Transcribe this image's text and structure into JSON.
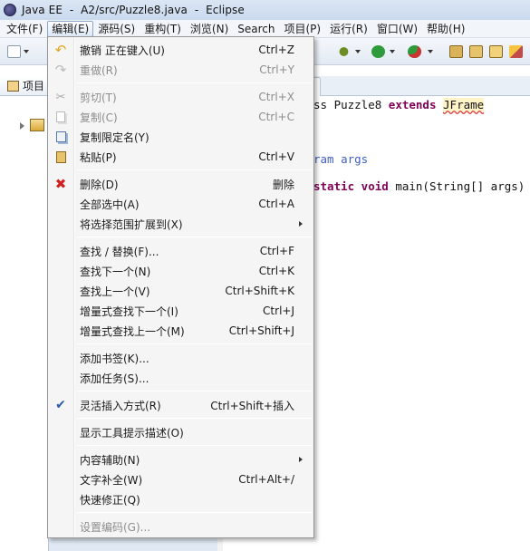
{
  "window": {
    "title": "Java EE  -  A2/src/Puzzle8.java  -  Eclipse"
  },
  "menubar": [
    {
      "name": "menu-file",
      "label": "文件(F)"
    },
    {
      "name": "menu-edit",
      "label": "编辑(E)",
      "active": true
    },
    {
      "name": "menu-source",
      "label": "源码(S)"
    },
    {
      "name": "menu-refactor",
      "label": "重构(T)"
    },
    {
      "name": "menu-navigate",
      "label": "浏览(N)"
    },
    {
      "name": "menu-search",
      "label": "Search"
    },
    {
      "name": "menu-project",
      "label": "项目(P)"
    },
    {
      "name": "menu-run",
      "label": "运行(R)"
    },
    {
      "name": "menu-window",
      "label": "窗口(W)"
    },
    {
      "name": "menu-help",
      "label": "帮助(H)"
    }
  ],
  "left_pane": {
    "tab_label": "项目"
  },
  "editor": {
    "code_lines": [
      {
        "pre": "ss Puzzle8 ",
        "kw": "extends",
        "post": " ",
        "warn": "JFrame"
      },
      {
        "jd": "ram args"
      },
      {
        "pre": "",
        "kw": "static void",
        "post": " main(String[] args)"
      }
    ]
  },
  "edit_menu": {
    "items": [
      {
        "type": "item",
        "name": "undo-typing",
        "icon": "undo-icon",
        "label": "撤销 正在键入(U)",
        "shortcut": "Ctrl+Z",
        "enabled": true
      },
      {
        "type": "item",
        "name": "redo",
        "icon": "redo-icon",
        "label": "重做(R)",
        "shortcut": "Ctrl+Y",
        "enabled": false
      },
      {
        "type": "sep"
      },
      {
        "type": "item",
        "name": "cut",
        "icon": "cut-icon",
        "label": "剪切(T)",
        "shortcut": "Ctrl+X",
        "enabled": false
      },
      {
        "type": "item",
        "name": "copy",
        "icon": "copy-icon",
        "label": "复制(C)",
        "shortcut": "Ctrl+C",
        "enabled": false
      },
      {
        "type": "item",
        "name": "copy-qualified-name",
        "icon": "copy-qualified-name-icon",
        "label": "复制限定名(Y)",
        "shortcut": "",
        "enabled": true
      },
      {
        "type": "item",
        "name": "paste",
        "icon": "paste-icon",
        "label": "粘贴(P)",
        "shortcut": "Ctrl+V",
        "enabled": true
      },
      {
        "type": "sep"
      },
      {
        "type": "item",
        "name": "delete",
        "icon": "delete-icon",
        "label": "删除(D)",
        "shortcut": "删除",
        "enabled": true
      },
      {
        "type": "item",
        "name": "select-all",
        "icon": "",
        "label": "全部选中(A)",
        "shortcut": "Ctrl+A",
        "enabled": true
      },
      {
        "type": "item",
        "name": "expand-selection",
        "icon": "",
        "label": "将选择范围扩展到(X)",
        "shortcut": "",
        "enabled": true,
        "submenu": true
      },
      {
        "type": "sep"
      },
      {
        "type": "item",
        "name": "find-replace",
        "icon": "",
        "label": "查找 / 替换(F)...",
        "shortcut": "Ctrl+F",
        "enabled": true
      },
      {
        "type": "item",
        "name": "find-next",
        "icon": "",
        "label": "查找下一个(N)",
        "shortcut": "Ctrl+K",
        "enabled": true
      },
      {
        "type": "item",
        "name": "find-previous",
        "icon": "",
        "label": "查找上一个(V)",
        "shortcut": "Ctrl+Shift+K",
        "enabled": true
      },
      {
        "type": "item",
        "name": "incremental-find-next",
        "icon": "",
        "label": "增量式查找下一个(I)",
        "shortcut": "Ctrl+J",
        "enabled": true
      },
      {
        "type": "item",
        "name": "incremental-find-previous",
        "icon": "",
        "label": "增量式查找上一个(M)",
        "shortcut": "Ctrl+Shift+J",
        "enabled": true
      },
      {
        "type": "sep"
      },
      {
        "type": "item",
        "name": "add-bookmark",
        "icon": "",
        "label": "添加书签(K)...",
        "shortcut": "",
        "enabled": true
      },
      {
        "type": "item",
        "name": "add-task",
        "icon": "",
        "label": "添加任务(S)...",
        "shortcut": "",
        "enabled": true
      },
      {
        "type": "sep"
      },
      {
        "type": "item",
        "name": "smart-insert-mode",
        "icon": "check-icon",
        "label": "灵活插入方式(R)",
        "shortcut": "Ctrl+Shift+插入",
        "enabled": true,
        "checked": true
      },
      {
        "type": "sep"
      },
      {
        "type": "item",
        "name": "show-tooltip-description",
        "icon": "",
        "label": "显示工具提示描述(O)",
        "shortcut": "",
        "enabled": true
      },
      {
        "type": "sep"
      },
      {
        "type": "item",
        "name": "content-assist",
        "icon": "",
        "label": "内容辅助(N)",
        "shortcut": "",
        "enabled": true,
        "submenu": true
      },
      {
        "type": "item",
        "name": "word-completion",
        "icon": "",
        "label": "文字补全(W)",
        "shortcut": "Ctrl+Alt+/",
        "enabled": true
      },
      {
        "type": "item",
        "name": "quick-fix",
        "icon": "",
        "label": "快速修正(Q)",
        "shortcut": "",
        "enabled": true
      },
      {
        "type": "sep"
      },
      {
        "type": "item",
        "name": "set-encoding",
        "icon": "",
        "label": "设置编码(G)...",
        "shortcut": "",
        "enabled": false
      }
    ]
  }
}
